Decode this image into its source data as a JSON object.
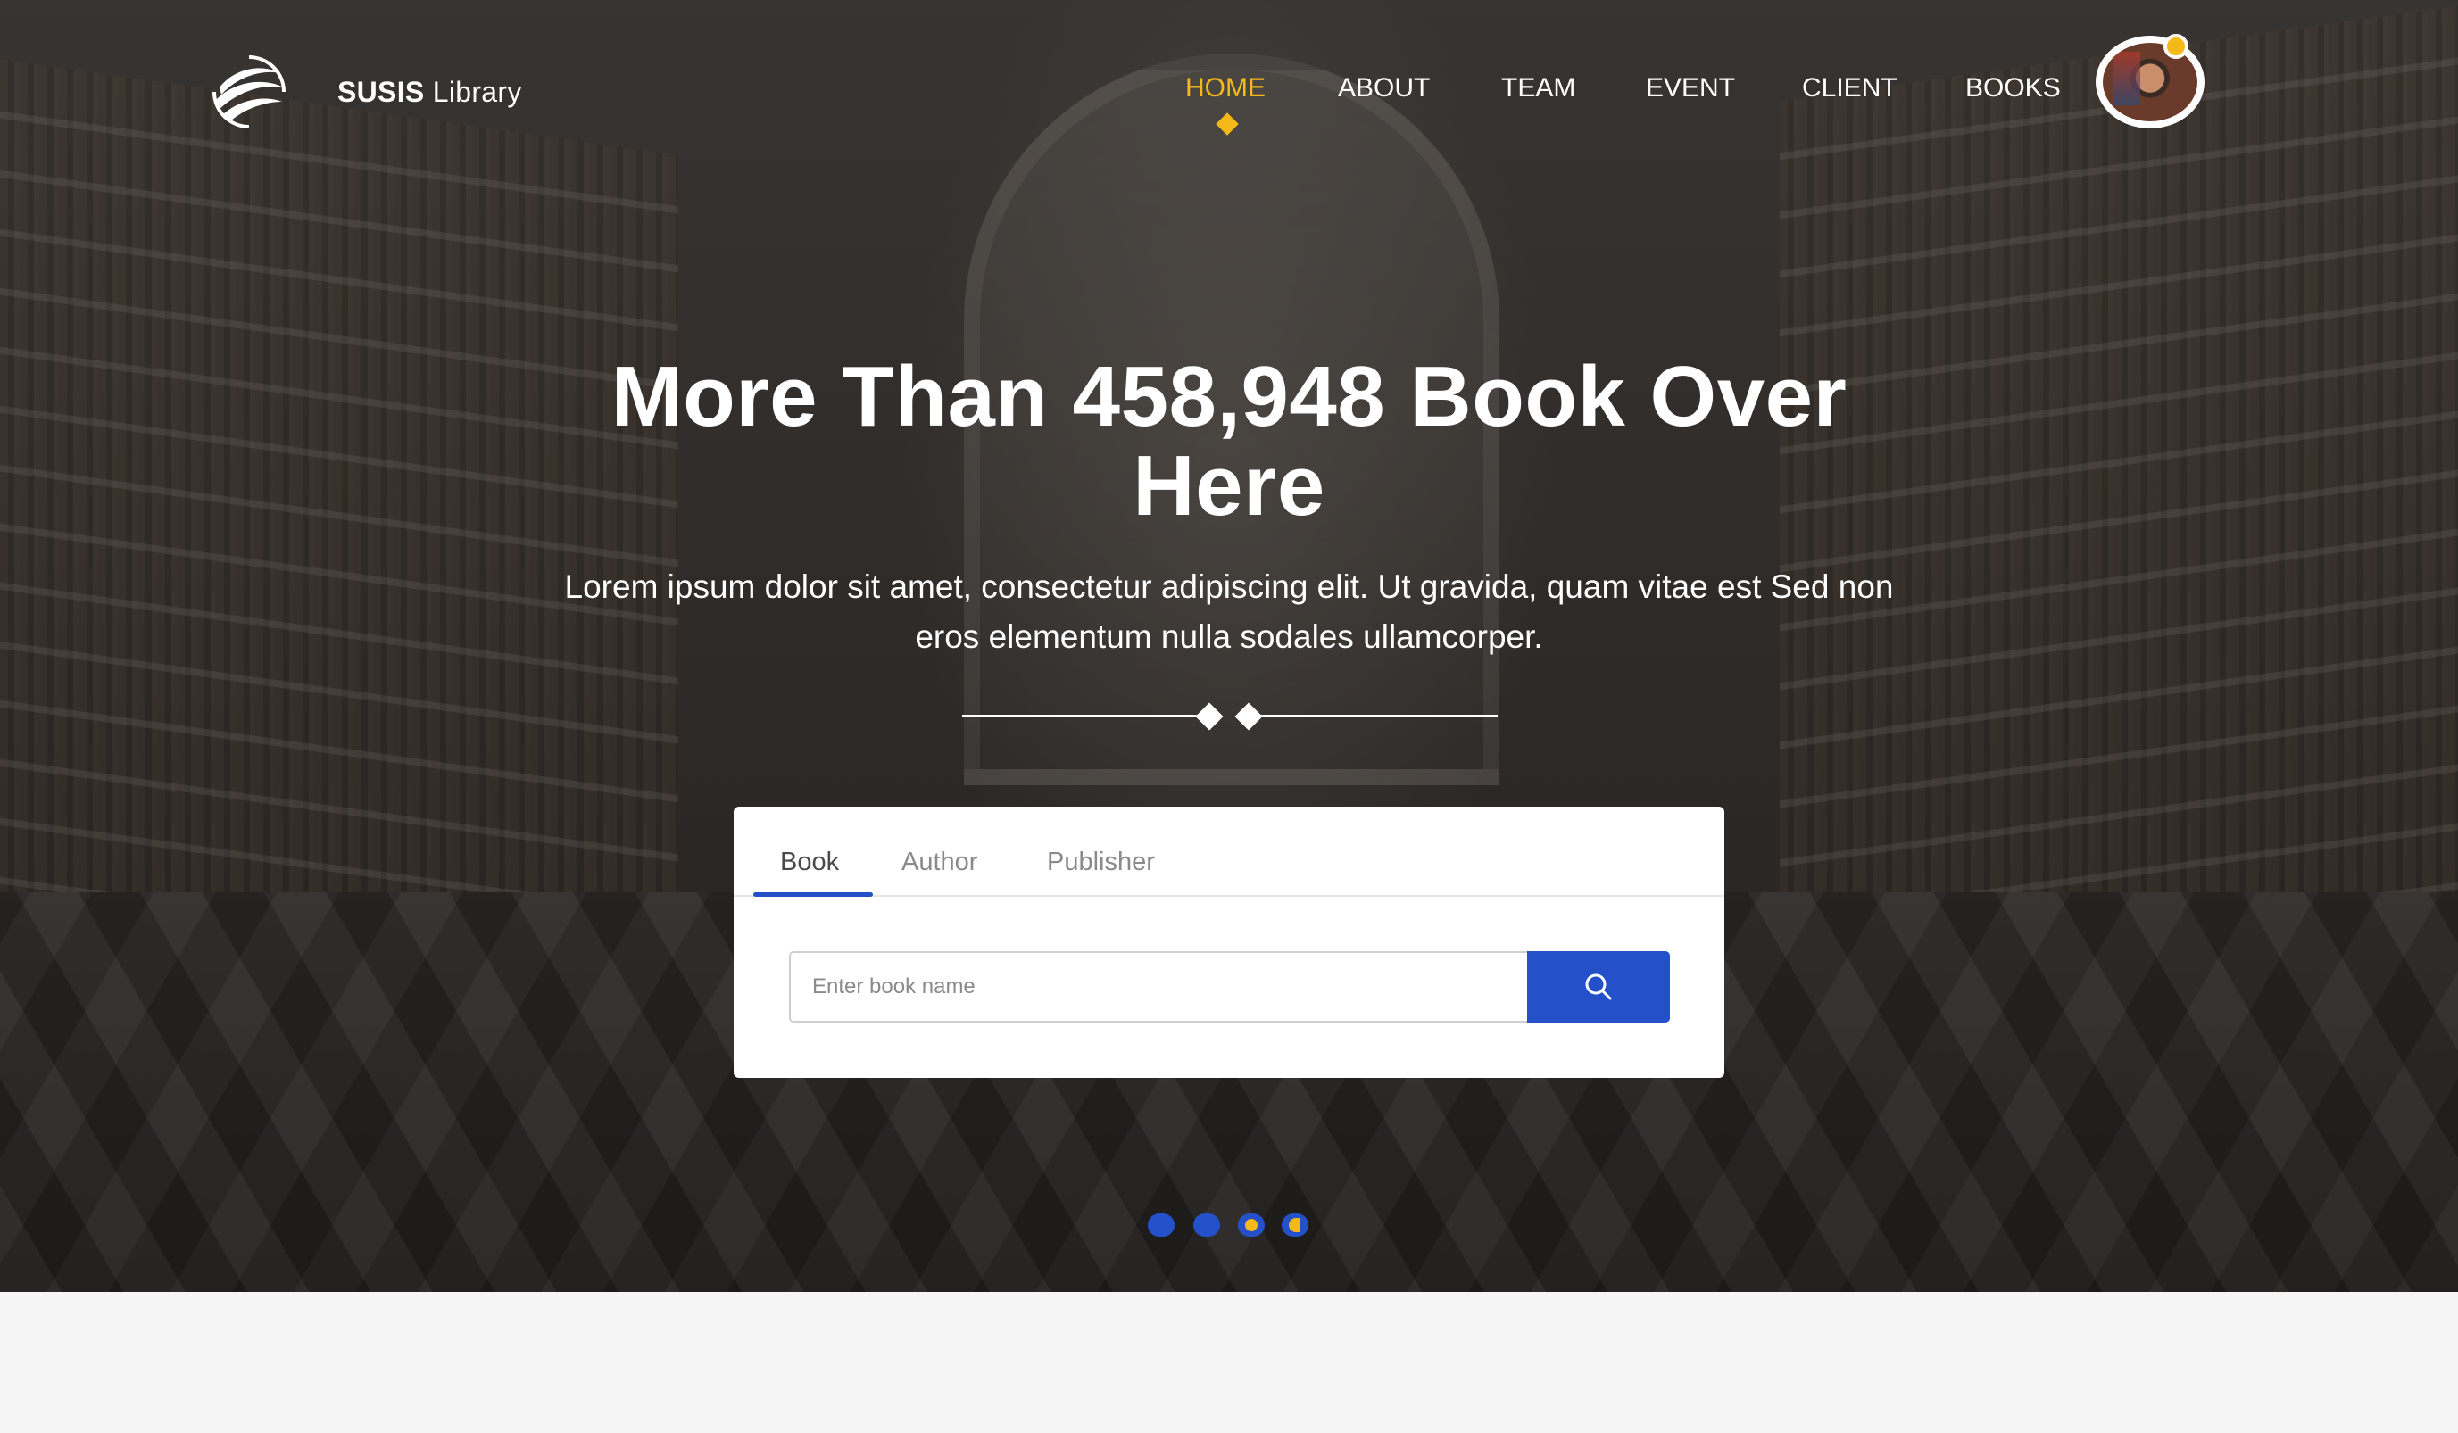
{
  "brand": {
    "name_bold": "SUSIS",
    "name_rest": "Library"
  },
  "nav": {
    "items": [
      {
        "label": "HOME",
        "active": true
      },
      {
        "label": "ABOUT",
        "active": false
      },
      {
        "label": "TEAM",
        "active": false
      },
      {
        "label": "EVENT",
        "active": false
      },
      {
        "label": "CLIENT",
        "active": false
      },
      {
        "label": "BOOKS",
        "active": false
      }
    ]
  },
  "hero": {
    "headline": "More Than 458,948 Book Over Here",
    "subtext": "Lorem ipsum dolor sit amet, consectetur adipiscing elit. Ut gravida, quam vitae est Sed non eros elementum nulla sodales ullamcorper."
  },
  "search": {
    "tabs": [
      "Book",
      "Author",
      "Publisher"
    ],
    "active_tab": "Book",
    "placeholder": "Enter book name",
    "value": ""
  },
  "carousel": {
    "slide_count": 4,
    "active_index": 2
  },
  "colors": {
    "accent": "#f5b919",
    "primary": "#2451c9",
    "text_light": "#ffffff",
    "page_bg": "#f5f5f5"
  },
  "icons": {
    "logo": "swirl-globe-logo",
    "search": "search-icon",
    "notification": "notification-dot"
  }
}
